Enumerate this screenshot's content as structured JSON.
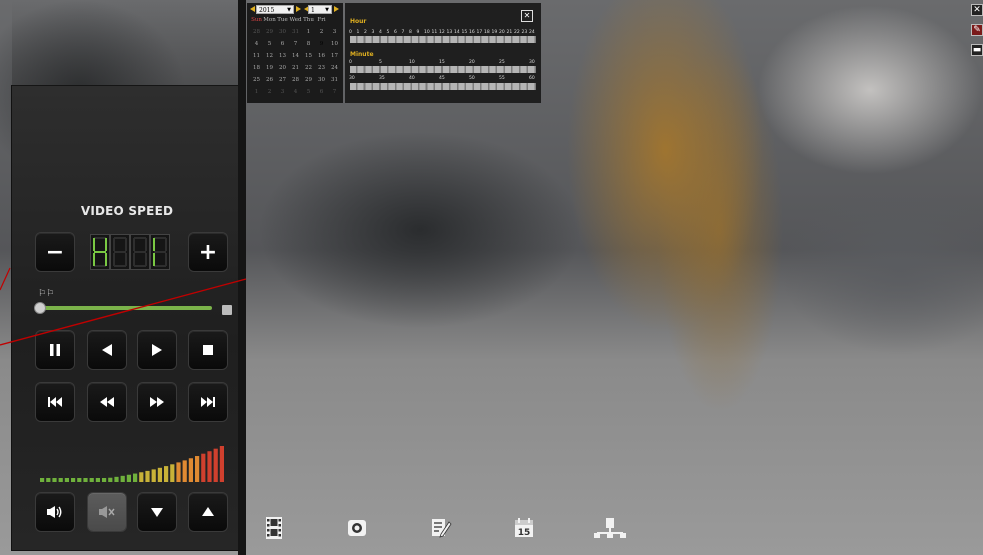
{
  "panel": {
    "title": "VIDEO SPEED",
    "speed_minus_label": "−",
    "speed_plus_label": "+"
  },
  "calendar": {
    "year": "2015",
    "month": "1",
    "weekdays": [
      "Sun",
      "Mon",
      "Tue",
      "Wed",
      "Thu",
      "Fri"
    ],
    "rows": [
      [
        "28",
        "29",
        "30",
        "31",
        "1",
        "2",
        "3"
      ],
      [
        "4",
        "5",
        "6",
        "7",
        "8",
        "9",
        "10"
      ],
      [
        "11",
        "12",
        "13",
        "14",
        "15",
        "16",
        "17"
      ],
      [
        "18",
        "19",
        "20",
        "21",
        "22",
        "23",
        "24"
      ],
      [
        "25",
        "26",
        "27",
        "28",
        "29",
        "30",
        "31"
      ],
      [
        "1",
        "2",
        "3",
        "4",
        "5",
        "6",
        "7"
      ]
    ],
    "selected_day": "9"
  },
  "time_picker": {
    "hour_label": "Hour",
    "hours": [
      "0",
      "1",
      "2",
      "3",
      "4",
      "5",
      "6",
      "7",
      "8",
      "9",
      "10",
      "11",
      "12",
      "13",
      "14",
      "15",
      "16",
      "17",
      "18",
      "19",
      "20",
      "21",
      "22",
      "23",
      "24"
    ],
    "minute_label": "Minute",
    "minutes": [
      "0",
      "5",
      "10",
      "15",
      "20",
      "25",
      "30"
    ],
    "minutes_row2": [
      "30",
      "35",
      "40",
      "45",
      "50",
      "55",
      "60"
    ]
  },
  "colors": {
    "accent_green": "#7ac943",
    "slider_green": "#7bb34a",
    "calendar_today": "#e8b010",
    "annotation_red": "#c00000"
  },
  "icons": {
    "window_buttons": [
      "close-icon",
      "edit-icon",
      "minimize-icon"
    ],
    "toolbar": [
      "film-icon",
      "camera-icon",
      "edit-note-icon",
      "calendar-icon",
      "network-icon"
    ]
  }
}
